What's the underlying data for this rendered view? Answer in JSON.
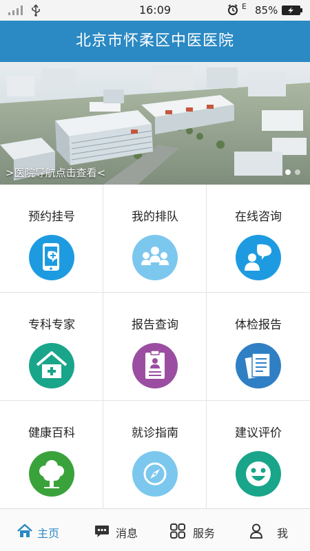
{
  "status_bar": {
    "time": "16:09",
    "battery_pct": "85%",
    "sim_label": "E"
  },
  "header": {
    "title": "北京市怀柔区中医医院"
  },
  "banner": {
    "caption": ">医院导航点击查看<",
    "slides": 2,
    "active_slide": 1
  },
  "grid": [
    {
      "label": "预约挂号",
      "icon": "phone-appointment-icon",
      "color": "#1e9be0"
    },
    {
      "label": "我的排队",
      "icon": "queue-people-icon",
      "color": "#7cc7ee"
    },
    {
      "label": "在线咨询",
      "icon": "chat-consult-icon",
      "color": "#1e9be0"
    },
    {
      "label": "专科专家",
      "icon": "hospital-house-icon",
      "color": "#19a58a"
    },
    {
      "label": "报告查询",
      "icon": "clipboard-report-icon",
      "color": "#9b4ea1"
    },
    {
      "label": "体检报告",
      "icon": "documents-report-icon",
      "color": "#2f7fc4"
    },
    {
      "label": "健康百科",
      "icon": "tree-icon",
      "color": "#3aa23b"
    },
    {
      "label": "就诊指南",
      "icon": "compass-icon",
      "color": "#7cc7ee"
    },
    {
      "label": "建议评价",
      "icon": "smiley-face-icon",
      "color": "#19a58a"
    }
  ],
  "tabs": [
    {
      "label": "主页",
      "icon": "home-icon",
      "active": true
    },
    {
      "label": "消息",
      "icon": "message-icon",
      "active": false
    },
    {
      "label": "服务",
      "icon": "grid-service-icon",
      "active": false
    },
    {
      "label": "我",
      "icon": "person-icon",
      "active": false
    }
  ],
  "colors": {
    "brand": "#2b89c3",
    "status_bar_bg": "#f4f4f4",
    "tab_active": "#2b89c3"
  }
}
